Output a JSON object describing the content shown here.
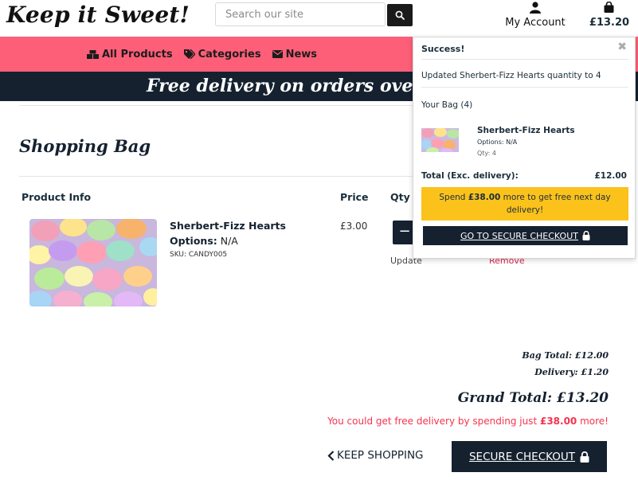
{
  "header": {
    "logo": "Keep it Sweet!",
    "search_placeholder": "Search our site",
    "account_label": "My Account",
    "bag_total": "£13.20"
  },
  "nav": {
    "items": [
      {
        "label": "All Products",
        "icon": "boxes-icon"
      },
      {
        "label": "Categories",
        "icon": "tags-icon"
      },
      {
        "label": "News",
        "icon": "envelope-icon"
      }
    ]
  },
  "promo": {
    "text": "Free delivery on orders over £"
  },
  "page": {
    "title": "Shopping Bag"
  },
  "table": {
    "headers": {
      "product": "Product Info",
      "price": "Price",
      "qty": "Qty"
    }
  },
  "item": {
    "name": "Sherbert-Fizz Hearts",
    "options_label": "Options:",
    "options_value": "N/A",
    "sku": "SKU: CANDY005",
    "price": "£3.00",
    "update_label": "Update",
    "remove_label": "Remove"
  },
  "summary": {
    "bag_total": "Bag Total: £12.00",
    "delivery": "Delivery: £1.20",
    "grand_total": "Grand Total: £13.20",
    "free_msg_prefix": "You could get free delivery by spending just ",
    "free_msg_amount": "£38.00",
    "free_msg_suffix": " more!",
    "keep_shopping": "KEEP SHOPPING",
    "secure_checkout": "SECURE CHECKOUT"
  },
  "popup": {
    "success": "Success!",
    "updated": "Updated Sherbert-Fizz Hearts quantity to 4",
    "your_bag": "Your Bag (4)",
    "item_name": "Sherbert-Fizz Hearts",
    "item_options": "Options: N/A",
    "item_qty": "Qty: 4",
    "total_label": "Total (Exc. delivery):",
    "total_value": "£12.00",
    "spend_prefix": "Spend ",
    "spend_amount": "£38.00",
    "spend_suffix": " more to get free next day delivery!",
    "checkout": "GO TO SECURE CHECKOUT"
  },
  "colors": {
    "navbar": "#fd5f78",
    "dark": "#15212f",
    "accent_red": "#f5334f",
    "spend_banner": "#fbc21c"
  }
}
